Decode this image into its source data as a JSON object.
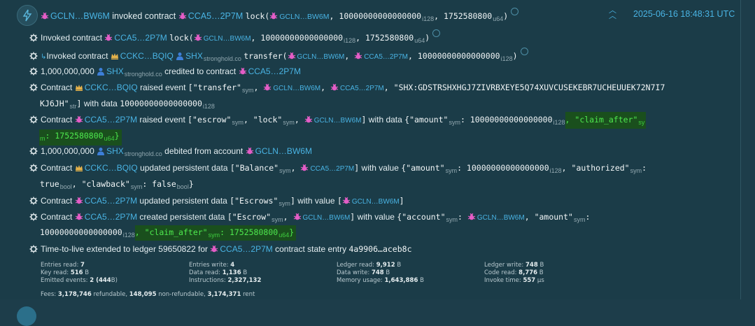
{
  "header": {
    "actor": "GCLN…BW6M",
    "verb": "invoked contract",
    "contract": "CCA5…2P7M",
    "fn": "lock(",
    "arg_account": "GCLN…BW6M",
    "amount": "10000000000000000",
    "amount_type": "i128",
    "claim": "1752580800",
    "claim_type": "u64",
    "close": ")",
    "timestamp": "2025-06-16 18:48:31 UTC"
  },
  "events": {
    "e1": {
      "text": "Invoked contract",
      "contract": "CCA5…2P7M",
      "fn": "lock(",
      "account": "GCLN…BW6M",
      "amount": "10000000000000000",
      "amount_type": "i128",
      "claim": "1752580800",
      "claim_type": "u64",
      "close": ")"
    },
    "e2": {
      "text": "Invoked contract",
      "contract": "CCKC…BQIQ",
      "token": "SHX",
      "token_domain": "stronghold.co",
      "fn": "transfer(",
      "from": "GCLN…BW6M",
      "to": "CCA5…2P7M",
      "amount": "10000000000000000",
      "amount_type": "i128",
      "close": ")"
    },
    "e3": {
      "amount": "1,000,000,000",
      "token": "SHX",
      "token_domain": "stronghold.co",
      "text": "credited to contract",
      "contract": "CCA5…2P7M"
    },
    "e4": {
      "pre": "Contract",
      "contract": "CCKC…BQIQ",
      "text": "raised event",
      "topic_open": "[\"transfer\"",
      "sym": "sym",
      "from": "GCLN…BW6M",
      "to": "CCA5…2P7M",
      "asset_line1": "\"SHX:GDSTRSHXHGJ7ZIVRBXEYE5Q74XUVCUSEKEBR7UCHEUUEK72N7I7",
      "asset_line2": "KJ6JH\"",
      "str": "str",
      "close": "]",
      "with_data": "with data",
      "data_val": "10000000000000000",
      "data_type": "i128"
    },
    "e5": {
      "pre": "Contract",
      "contract": "CCA5…2P7M",
      "text": "raised event",
      "topic_open": "[\"escrow\"",
      "sym": "sym",
      "topic2": "\"lock\"",
      "account": "GCLN…BW6M",
      "close": "]",
      "with_data": "with data",
      "brace": "{\"amount\"",
      "amount": ": 10000000000000000",
      "amount_type": "i128",
      "claim_key": "\"claim_after\"",
      "claim_key_sub_1": "sy",
      "claim_key_sub_2": "m",
      "claim_val": ": 1752580800",
      "claim_type": "u64",
      "close_brace": "}"
    },
    "e6": {
      "amount": "1,000,000,000",
      "token": "SHX",
      "token_domain": "stronghold.co",
      "text": "debited from account",
      "account": "GCLN…BW6M"
    },
    "e7": {
      "pre": "Contract",
      "contract": "CCKC…BQIQ",
      "text": "updated persistent data",
      "key_open": "[\"Balance\"",
      "sym": "sym",
      "key_contract": "CCA5…2P7M",
      "close": "]",
      "with_value": "with value",
      "v_amount": "{\"amount\"",
      "v_amount_val": ": 10000000000000000",
      "i128": "i128",
      "v_auth": "\"authorized\"",
      "v_auth_colon": ":",
      "v_true": "true",
      "bool": "bool",
      "v_claw": "\"clawback\"",
      "v_false": ": false",
      "close_brace": "}"
    },
    "e8": {
      "pre": "Contract",
      "contract": "CCA5…2P7M",
      "text": "updated persistent data",
      "key_open": "[\"Escrows\"",
      "sym": "sym",
      "close": "]",
      "with_value": "with value",
      "val_open": "[",
      "val_account": "GCLN…BW6M",
      "val_close": "]"
    },
    "e9": {
      "pre": "Contract",
      "contract": "CCA5…2P7M",
      "text": "created persistent data",
      "key_open": "[\"Escrow\"",
      "sym": "sym",
      "key_account": "GCLN…BW6M",
      "close": "]",
      "with_value": "with value",
      "v_account": "{\"account\"",
      "v_account_val": "GCLN…BW6M",
      "v_amount": "\"amount\"",
      "v_amount_val": "10000000000000000",
      "i128": "i128",
      "claim_key": "\"claim_after\"",
      "claim_val": ": 1752580800",
      "claim_type": "u64",
      "close_brace": "}"
    },
    "e10": {
      "text": "Time-to-live extended to ledger 59650822 for",
      "contract": "CCA5…2P7M",
      "text2": "contract state entry",
      "entry": "4a9906…aceb8c"
    }
  },
  "stats": {
    "entries_read_label": "Entries read:",
    "entries_read": "7",
    "key_read_label": "Key read:",
    "key_read": "516",
    "key_read_unit": "B",
    "emitted_label": "Emitted events:",
    "emitted": "2 (444",
    "emitted_unit": "B)",
    "entries_write_label": "Entries write:",
    "entries_write": "4",
    "data_read_label": "Data read:",
    "data_read": "1,136",
    "data_read_unit": "B",
    "instructions_label": "Instructions:",
    "instructions": "2,327,132",
    "ledger_read_label": "Ledger read:",
    "ledger_read": "9,912",
    "ledger_read_unit": "B",
    "data_write_label": "Data write:",
    "data_write": "748",
    "data_write_unit": "B",
    "memory_label": "Memory usage:",
    "memory": "1,643,886",
    "memory_unit": "B",
    "ledger_write_label": "Ledger write:",
    "ledger_write": "748",
    "ledger_write_unit": "B",
    "code_read_label": "Code read:",
    "code_read": "8,776",
    "code_read_unit": "B",
    "invoke_label": "Invoke time:",
    "invoke": "557",
    "invoke_unit": "μs",
    "fees_label": "Fees:",
    "fees_ref": "3,178,746",
    "fees_ref_label": "refundable,",
    "fees_non": "148,095",
    "fees_non_label": "non-refundable,",
    "fees_rent": "3,174,371",
    "fees_rent_label": "rent"
  },
  "colors": {
    "link": "#49b3e3",
    "highlight_bg": "#1a4f1d",
    "highlight_text": "#4ee94e",
    "panel": "#1b3c48"
  }
}
